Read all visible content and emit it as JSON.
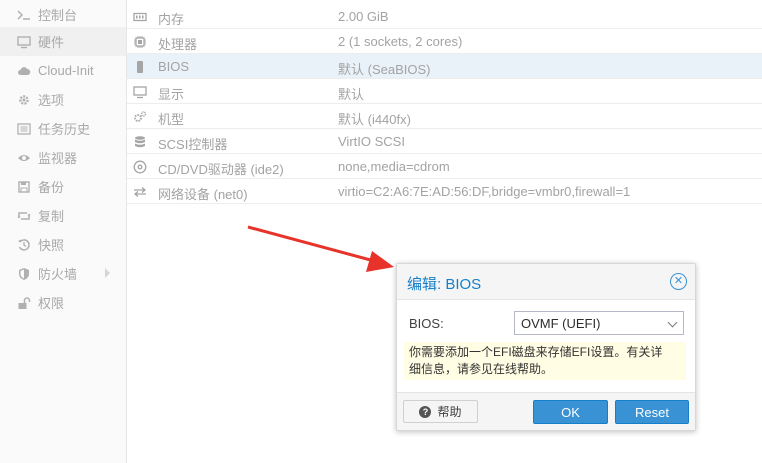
{
  "sidebar": {
    "items": [
      {
        "label": "控制台",
        "icon": "terminal-icon"
      },
      {
        "label": "硬件",
        "icon": "monitor-icon",
        "active": true
      },
      {
        "label": "Cloud-Init",
        "icon": "cloud-icon"
      },
      {
        "label": "选项",
        "icon": "gear-icon"
      },
      {
        "label": "任务历史",
        "icon": "list-icon"
      },
      {
        "label": "监视器",
        "icon": "eye-icon"
      },
      {
        "label": "备份",
        "icon": "floppy-icon"
      },
      {
        "label": "复制",
        "icon": "retweet-icon"
      },
      {
        "label": "快照",
        "icon": "history-icon"
      },
      {
        "label": "防火墙",
        "icon": "shield-icon",
        "has_submenu": true
      },
      {
        "label": "权限",
        "icon": "unlock-icon"
      }
    ]
  },
  "hardware": {
    "rows": [
      {
        "name": "内存",
        "value": "2.00 GiB",
        "icon": "memory-icon"
      },
      {
        "name": "处理器",
        "value": "2 (1 sockets, 2 cores)",
        "icon": "cpu-icon"
      },
      {
        "name": "BIOS",
        "value": "默认 (SeaBIOS)",
        "icon": "bios-icon",
        "selected": true
      },
      {
        "name": "显示",
        "value": "默认",
        "icon": "display-icon"
      },
      {
        "name": "机型",
        "value": "默认 (i440fx)",
        "icon": "cogs-icon"
      },
      {
        "name": "SCSI控制器",
        "value": "VirtIO SCSI",
        "icon": "database-icon"
      },
      {
        "name": "CD/DVD驱动器 (ide2)",
        "value": "none,media=cdrom",
        "icon": "cdrom-icon"
      },
      {
        "name": "网络设备 (net0)",
        "value": "virtio=C2:A6:7E:AD:56:DF,bridge=vmbr0,firewall=1",
        "icon": "exchange-icon"
      }
    ]
  },
  "dialog": {
    "title": "编辑: BIOS",
    "field_label": "BIOS:",
    "selected_value": "OVMF (UEFI)",
    "note_line1": "你需要添加一个EFI磁盘来存储EFI设置。有关详",
    "note_line2": "细信息，请参见在线帮助。",
    "help_label": "帮助",
    "ok_label": "OK",
    "reset_label": "Reset"
  },
  "colors": {
    "accent": "#3892d4",
    "title": "#157fcc",
    "arrow": "#e8332a",
    "note_bg": "#fffde3",
    "selected_row": "#e9f1f9"
  }
}
